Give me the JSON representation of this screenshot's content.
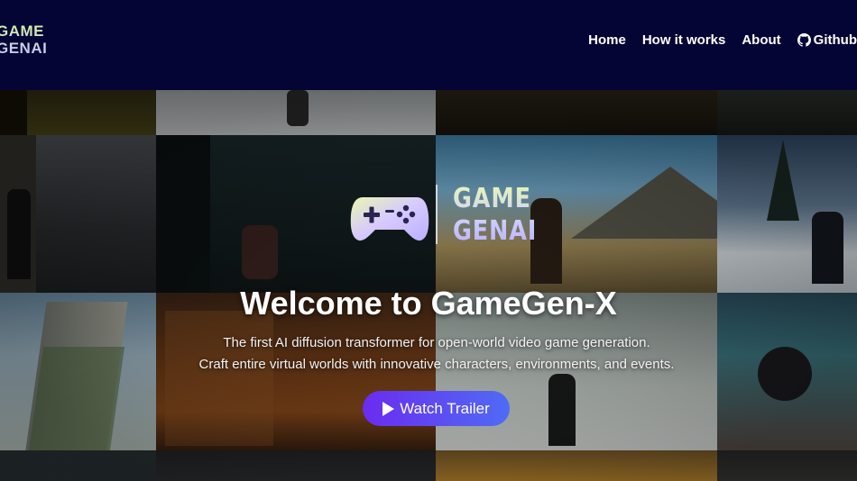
{
  "brand": {
    "logo_line1": "GAME",
    "logo_line2": "GENAI"
  },
  "nav": {
    "home": "Home",
    "how_it_works": "How it works",
    "about": "About",
    "github": "Github"
  },
  "hero": {
    "logo_line1": "GAME",
    "logo_line2": "GENAI",
    "title": "Welcome to GameGen-X",
    "subtitle_line1": "The first AI diffusion transformer for open-world video game generation.",
    "subtitle_line2": "Craft entire virtual worlds with innovative characters, environments, and events.",
    "cta_label": "Watch Trailer"
  },
  "colors": {
    "nav_bg": "#050535",
    "cta_start": "#6a2cf0",
    "cta_end": "#4f6bf5"
  }
}
